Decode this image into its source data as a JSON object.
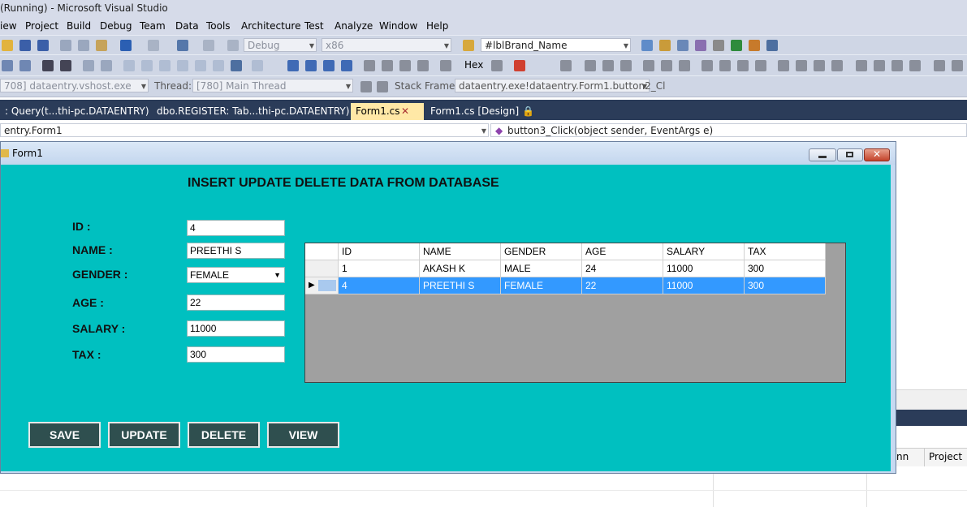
{
  "window": {
    "title": "(Running) - Microsoft Visual Studio"
  },
  "menu": [
    "iew",
    "Project",
    "Build",
    "Debug",
    "Team",
    "Data",
    "Tools",
    "Architecture",
    "Test",
    "Analyze",
    "Window",
    "Help"
  ],
  "toolbar": {
    "config": "Debug",
    "platform": "x86",
    "find_combo": "#lblBrand_Name",
    "hex_label": "Hex",
    "process": "708] dataentry.vshost.exe",
    "thread_label": "Thread:",
    "thread_value": "[780] Main Thread",
    "stack_label": "Stack Frame:",
    "stack_value": "dataentry.exe!dataentry.Form1.button2_Cl"
  },
  "doc_tabs": [
    {
      "label": ": Query(t...thi-pc.DATAENTRY)"
    },
    {
      "label": "dbo.REGISTER: Tab...thi-pc.DATAENTRY)"
    },
    {
      "label": "Form1.cs"
    },
    {
      "label": "Form1.cs [Design]"
    }
  ],
  "nav": {
    "left": "entry.Form1",
    "right": "button3_Click(object sender, EventArgs e)"
  },
  "form": {
    "title": "Form1",
    "heading": "INSERT UPDATE DELETE DATA FROM DATABASE",
    "labels": {
      "id": "ID  :",
      "name": "NAME  :",
      "gender": "GENDER  :",
      "age": "AGE  :",
      "salary": "SALARY  :",
      "tax": "TAX  :"
    },
    "values": {
      "id": "4",
      "name": "PREETHI S",
      "gender": "FEMALE",
      "age": "22",
      "salary": "11000",
      "tax": "300"
    },
    "buttons": {
      "save": "SAVE",
      "update": "UPDATE",
      "delete": "DELETE",
      "view": "VIEW"
    }
  },
  "grid": {
    "columns": [
      "ID",
      "NAME",
      "GENDER",
      "AGE",
      "SALARY",
      "TAX"
    ],
    "rows": [
      [
        "1",
        "AKASH K",
        "MALE",
        "24",
        "11000",
        "300"
      ],
      [
        "4",
        "PREETHI S",
        "FEMALE",
        "22",
        "11000",
        "300"
      ]
    ],
    "selected_row": 1
  },
  "side": {
    "col_a": "nn",
    "col_b": "Project"
  },
  "colors": {
    "form_bg": "#00c0c0",
    "button_bg": "#2f4f4f",
    "selection": "#3399ff",
    "tab_bar": "#2b3c59"
  }
}
